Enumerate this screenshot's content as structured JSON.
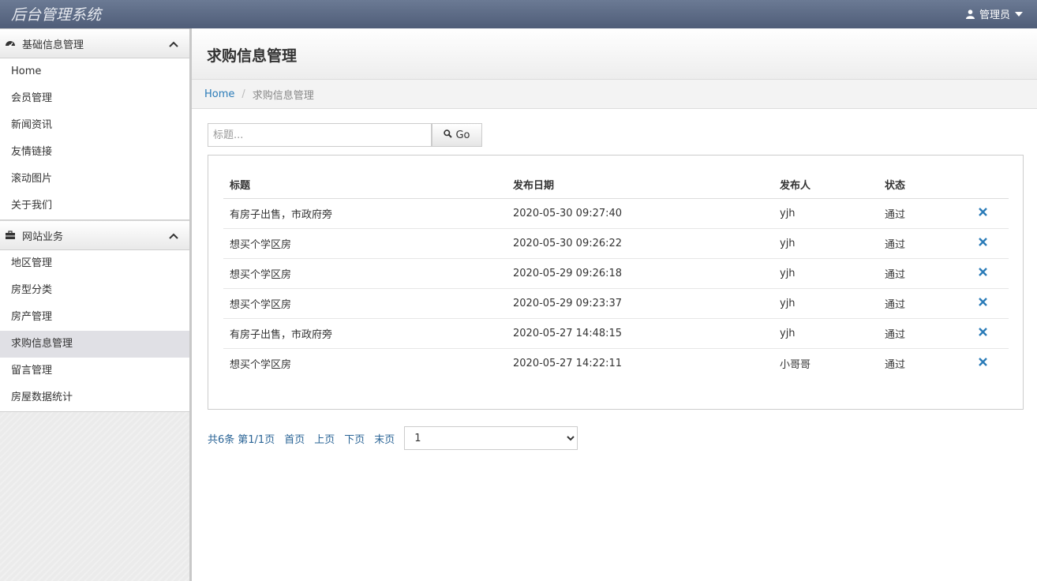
{
  "app": {
    "brand": "后台管理系统",
    "user_label": "管理员"
  },
  "sidebar": {
    "groups": [
      {
        "title": "基础信息管理",
        "items": [
          "Home",
          "会员管理",
          "新闻资讯",
          "友情链接",
          "滚动图片",
          "关于我们"
        ]
      },
      {
        "title": "网站业务",
        "items": [
          "地区管理",
          "房型分类",
          "房产管理",
          "求购信息管理",
          "留言管理",
          "房屋数据统计"
        ]
      }
    ],
    "active_item": "求购信息管理"
  },
  "page": {
    "title": "求购信息管理",
    "breadcrumb": {
      "home": "Home",
      "separator": "/",
      "current": "求购信息管理"
    }
  },
  "search": {
    "placeholder": "标题...",
    "button_label": "Go"
  },
  "table": {
    "headers": [
      "标题",
      "发布日期",
      "发布人",
      "状态"
    ],
    "rows": [
      {
        "title": "有房子出售，市政府旁",
        "date": "2020-05-30 09:27:40",
        "user": "yjh",
        "status": "通过"
      },
      {
        "title": "想买个学区房",
        "date": "2020-05-30 09:26:22",
        "user": "yjh",
        "status": "通过"
      },
      {
        "title": "想买个学区房",
        "date": "2020-05-29 09:26:18",
        "user": "yjh",
        "status": "通过"
      },
      {
        "title": "想买个学区房",
        "date": "2020-05-29 09:23:37",
        "user": "yjh",
        "status": "通过"
      },
      {
        "title": "有房子出售，市政府旁",
        "date": "2020-05-27 14:48:15",
        "user": "yjh",
        "status": "通过"
      },
      {
        "title": "想买个学区房",
        "date": "2020-05-27 14:22:11",
        "user": "小哥哥",
        "status": "通过"
      }
    ],
    "delete_icon": "close-icon"
  },
  "pagination": {
    "total": "共6条",
    "page_info": "第1/1页",
    "first": "首页",
    "prev": "上页",
    "next": "下页",
    "last": "末页",
    "selected_page": "1"
  },
  "colors": {
    "topbar": "#5a6884",
    "link": "#2a7bb8",
    "delete": "#2a7bb8"
  }
}
